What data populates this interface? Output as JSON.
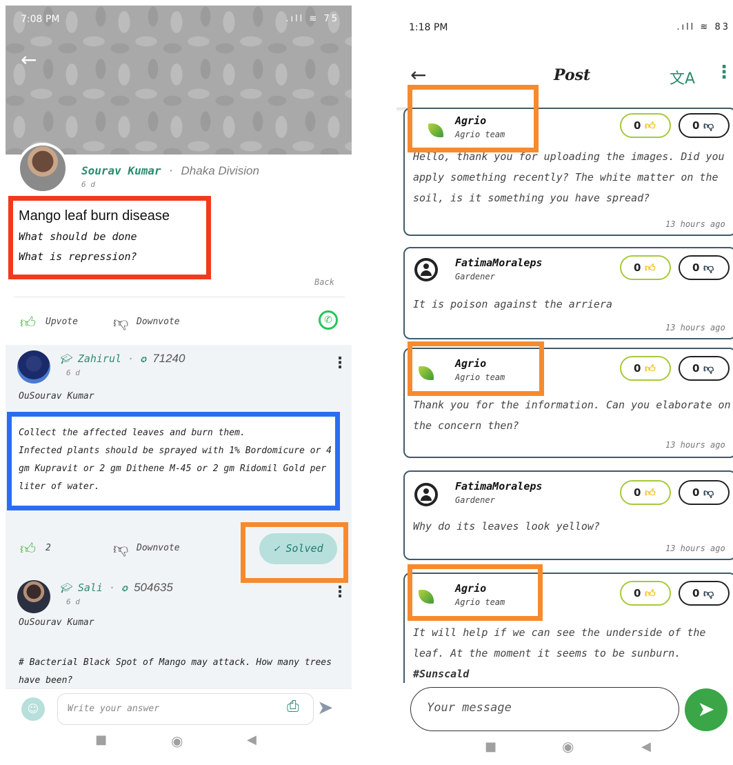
{
  "left": {
    "status_time": "7:08 PM",
    "status_right": ".ıll ≋ 75",
    "author": {
      "name": "Sourav Kumar",
      "separator": "·",
      "place": "Dhaka Division",
      "time": "6 d"
    },
    "question": {
      "title": "Mango leaf burn disease",
      "line1": "What should be done",
      "line2": "What is repression?"
    },
    "back_text": "Back",
    "post_votes": {
      "upvote": "Upvote",
      "downvote": "Downvote"
    },
    "answer1": {
      "name": "Zahirul",
      "points": "71240",
      "time": "6 d",
      "mention": "OuSourav Kumar",
      "line1": "Collect the affected leaves and burn them.",
      "line2": "Infected plants should be sprayed with 1% Bordomicure or 4 gm Kupravit or 2 gm Dithene M-45 or 2 gm Ridomil Gold per liter of water.",
      "upvotes": "2",
      "downvote": "Downvote",
      "solved": "Solved"
    },
    "answer2": {
      "name": "Sali",
      "points": "504635",
      "time": "6 d",
      "mention": "OuSourav Kumar",
      "text": "# Bacterial Black Spot of Mango may attack. How many trees have been?"
    },
    "input_placeholder": "Write your answer",
    "separator": "·"
  },
  "right": {
    "status_time": "1:18 PM",
    "status_right": ".ıll ≋ 83",
    "title": "Post",
    "comments": [
      {
        "name": "Agrio",
        "role": "Agrio team",
        "up": "0",
        "down": "0",
        "text": "Hello, thank you for uploading the images. Did you apply something recently? The white matter on the soil, is it something you have spread?",
        "time": "13 hours ago"
      },
      {
        "name": "FatimaMoraleps",
        "role": "Gardener",
        "up": "0",
        "down": "0",
        "text": "It is poison against the arriera",
        "time": "13 hours ago"
      },
      {
        "name": "Agrio",
        "role": "Agrio team",
        "up": "0",
        "down": "0",
        "text": "Thank you for the information. Can you elaborate on the concern then?",
        "time": "13 hours ago"
      },
      {
        "name": "FatimaMoraleps",
        "role": "Gardener",
        "up": "0",
        "down": "0",
        "text": "Why do its leaves look yellow?",
        "time": "13 hours ago"
      },
      {
        "name": "Agrio",
        "role": "Agrio team",
        "up": "0",
        "down": "0",
        "text": "It will help if we can see the underside of the leaf. At the moment it seems to be sunburn.",
        "hashtag": "#Sunscald"
      }
    ],
    "input_placeholder": "Your message"
  },
  "colors": {
    "green": "#2e8b6e",
    "red_box": "#f2391d",
    "blue_box": "#2b6df2",
    "orange_box": "#f68a2e",
    "send": "#3aa648"
  }
}
